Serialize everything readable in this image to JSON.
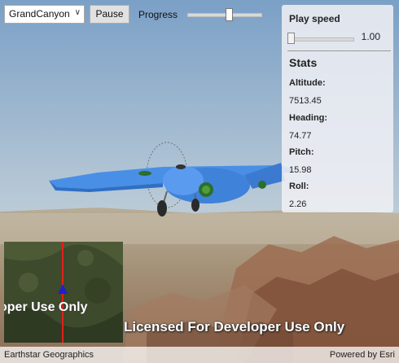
{
  "toolbar": {
    "selected_flight": "GrandCanyon",
    "pause_label": "Pause",
    "progress_label": "Progress",
    "progress_fraction": 0.55
  },
  "panel": {
    "play_speed_label": "Play speed",
    "play_speed_value": "1.00",
    "play_speed_fraction": 0.02,
    "stats_title": "Stats",
    "stats": [
      {
        "label": "Altitude:",
        "value": "7513.45"
      },
      {
        "label": "Heading:",
        "value": "74.77"
      },
      {
        "label": "Pitch:",
        "value": "15.98"
      },
      {
        "label": "Roll:",
        "value": "2.26"
      }
    ]
  },
  "watermark": "Licensed For Developer Use Only",
  "minimap_watermark": "oper Use Only",
  "attribution": {
    "left": "Earthstar Geographics",
    "right": "Powered by Esri"
  },
  "colors": {
    "airplane": "#4a8fe6",
    "flight_path": "#e0201c",
    "position_marker": "#2020c8"
  }
}
